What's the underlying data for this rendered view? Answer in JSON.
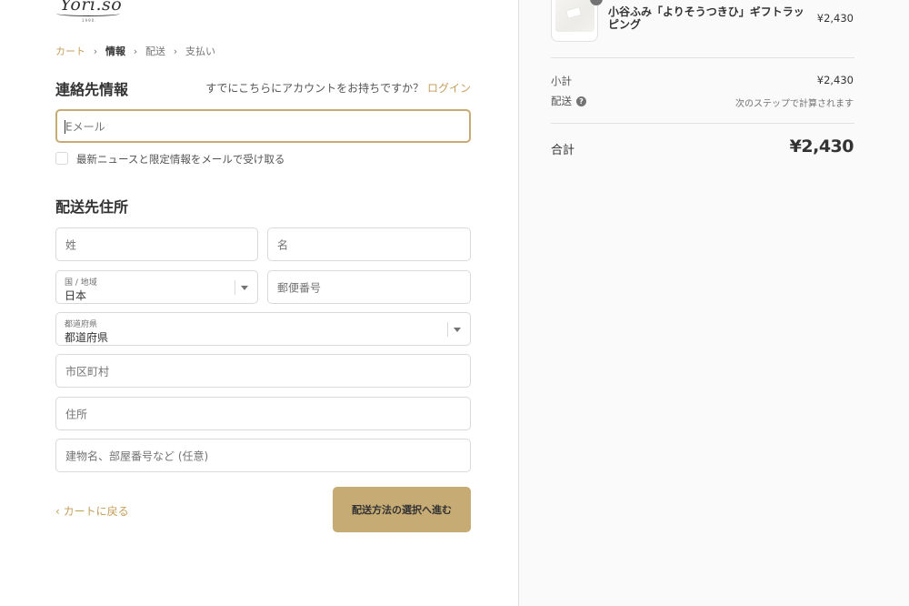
{
  "brand": {
    "logo_text": "Yori.so",
    "logo_sub": "1990."
  },
  "breadcrumb": [
    {
      "label": "カート"
    },
    {
      "label": "情報"
    },
    {
      "label": "配送"
    },
    {
      "label": "支払い"
    }
  ],
  "contact": {
    "title": "連絡先情報",
    "have_account": "すでにこちらにアカウントをお持ちですか？",
    "login_label": "ログイン",
    "email_placeholder": "Eメール",
    "newsletter_label": "最新ニュースと限定情報をメールで受け取る"
  },
  "shipping": {
    "title": "配送先住所",
    "last_name_placeholder": "姓",
    "first_name_placeholder": "名",
    "country_label": "国 / 地域",
    "country_value": "日本",
    "postal_placeholder": "郵便番号",
    "prefecture_label": "都道府県",
    "prefecture_value": "都道府県",
    "city_placeholder": "市区町村",
    "address_placeholder": "住所",
    "building_placeholder": "建物名、部屋番号など (任意)"
  },
  "actions": {
    "back_label": "カートに戻る",
    "continue_label": "配送方法の選択へ進む"
  },
  "summary": {
    "product_name": "小谷ふみ「よりそうつきひ」ギフトラッピング",
    "product_price": "¥2,430",
    "subtotal_label": "小計",
    "subtotal_value": "¥2,430",
    "shipping_label": "配送",
    "shipping_value": "次のステップで計算されます",
    "total_label": "合計",
    "total_value": "¥2,430"
  },
  "colors": {
    "accent": "#c7ab74",
    "link": "#c49e5c",
    "sidebar_bg": "#fafafa"
  },
  "icons": [
    "chevron-right-icon",
    "chevron-left-icon",
    "chevron-down-icon",
    "help-icon"
  ]
}
